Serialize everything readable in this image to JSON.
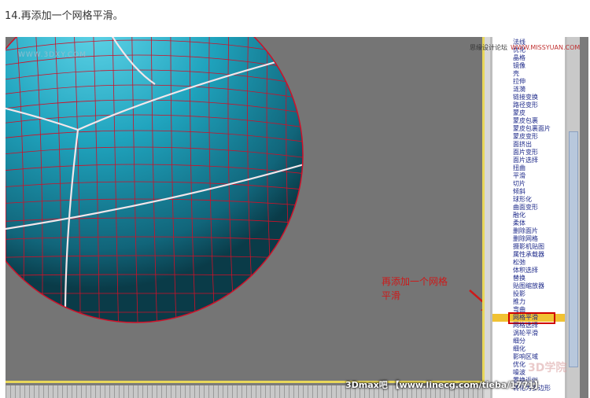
{
  "heading": "14.再添加一个网格平滑。",
  "viewport": {
    "watermark": "WWW.3DXY.COM",
    "colors": {
      "sphere": "#1fa3bd",
      "wire": "#d01028",
      "background": "#757575"
    }
  },
  "panel_watermark": {
    "site": "思缘设计论坛",
    "url": "WWW.MISSYUAN.COM"
  },
  "annotation": {
    "line1": "再添加一个网格",
    "line2": "平滑"
  },
  "modifier_list": {
    "items": [
      "法线",
      "优化",
      "晶格",
      "镜像",
      "壳",
      "拉伸",
      "涟漪",
      "链接变换",
      "路径变形",
      "蒙皮",
      "蒙皮包裹",
      "蒙皮包裹面片",
      "蒙皮变形",
      "面挤出",
      "面片变形",
      "面片选择",
      "扭曲",
      "平滑",
      "切片",
      "倾斜",
      "球形化",
      "曲面变形",
      "融化",
      "柔体",
      "删除面片",
      "删除网格",
      "摄影机贴图",
      "属性承载器",
      "松弛",
      "体积选择",
      "替换",
      "贴图缩放器",
      "投影",
      "推力",
      "弯曲",
      "网格平滑",
      "网格选择",
      "涡轮平滑",
      "细分",
      "细化",
      "影响区域",
      "优化",
      "噪波",
      "置换近似",
      "转化为多边形"
    ],
    "selected": "网格平滑",
    "highlight_color": "#f1c232"
  },
  "bottom_watermark": "3Dmax吧 【www.linecg.com/tieba/1771】",
  "corner_logo": "3D学院"
}
